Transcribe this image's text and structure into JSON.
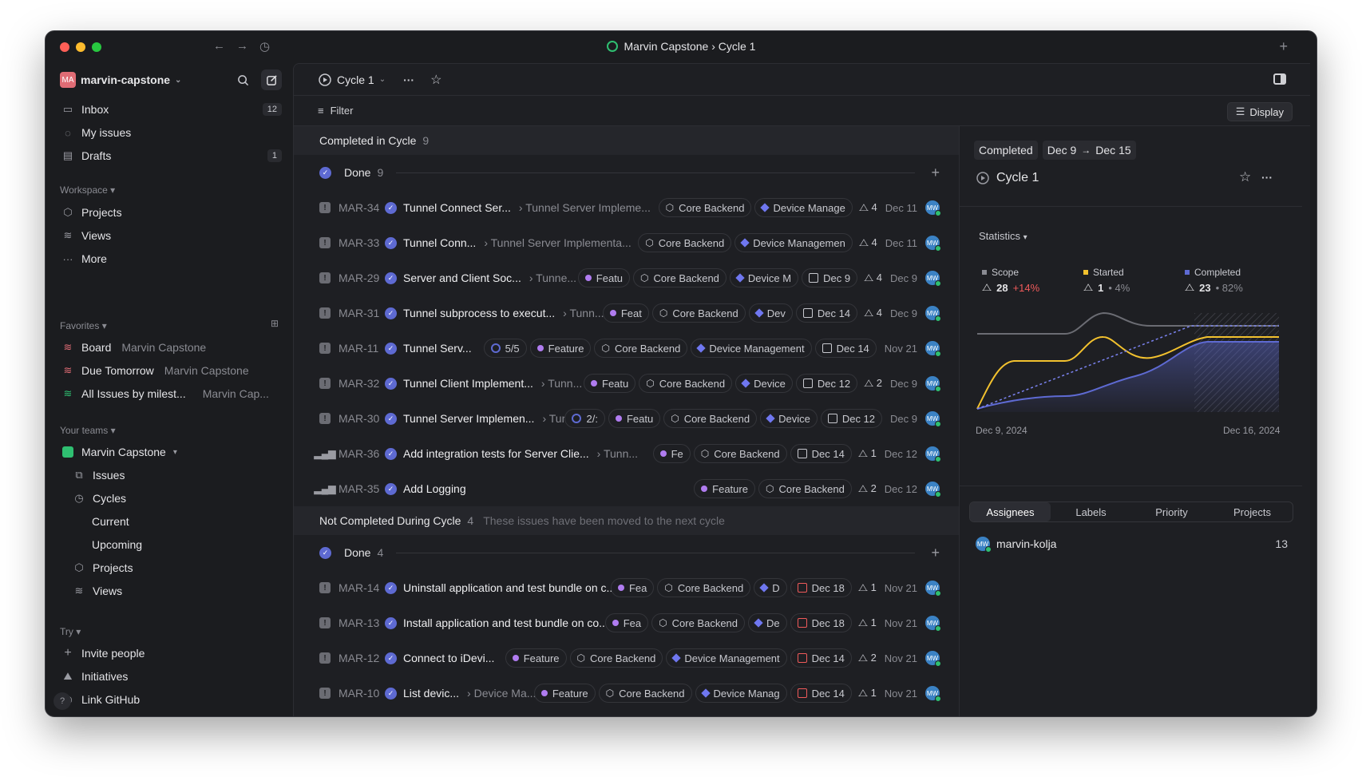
{
  "window": {
    "title": "Marvin Capstone › Cycle 1",
    "traffic_colors": [
      "#ff5f57",
      "#febc2e",
      "#28c840"
    ]
  },
  "sidebar": {
    "workspace_initials": "MA",
    "workspace_name": "marvin-capstone",
    "top_items": [
      {
        "label": "Inbox",
        "badge": "12"
      },
      {
        "label": "My issues",
        "badge": ""
      },
      {
        "label": "Drafts",
        "badge": "1"
      }
    ],
    "workspace_header": "Workspace",
    "workspace_items": [
      {
        "label": "Projects"
      },
      {
        "label": "Views"
      },
      {
        "label": "More"
      }
    ],
    "favorites_header": "Favorites",
    "favorites": [
      {
        "label": "Board",
        "sub": "Marvin Capstone"
      },
      {
        "label": "Due Tomorrow",
        "sub": "Marvin Capstone"
      },
      {
        "label": "All Issues by milest...",
        "sub": "Marvin Cap..."
      }
    ],
    "teams_header": "Your teams",
    "team_name": "Marvin Capstone",
    "team_items": [
      {
        "label": "Issues"
      },
      {
        "label": "Cycles"
      },
      {
        "label": "Current"
      },
      {
        "label": "Upcoming"
      },
      {
        "label": "Projects"
      },
      {
        "label": "Views"
      }
    ],
    "try_header": "Try",
    "try_items": [
      {
        "label": "Invite people"
      },
      {
        "label": "Initiatives"
      },
      {
        "label": "Link GitHub"
      }
    ],
    "help_label": "?"
  },
  "topbar": {
    "cycle_label": "Cycle 1",
    "filter_label": "Filter",
    "display_label": "Display"
  },
  "list": {
    "section1": {
      "label": "Completed in Cycle",
      "count": "9"
    },
    "group1": {
      "label": "Done",
      "count": "9"
    },
    "section2": {
      "label": "Not Completed During Cycle",
      "count": "4",
      "note": "These issues have been moved to the next cycle"
    },
    "group2": {
      "label": "Done",
      "count": "4"
    },
    "issues": [
      {
        "id": "MAR-34",
        "title": "Tunnel Connect Ser...",
        "parent": "Tunnel Server Impleme...",
        "est": "4",
        "date": "Dec 11"
      },
      {
        "id": "MAR-33",
        "title": "Tunnel Conn...",
        "parent": "Tunnel Server Implementa...",
        "est": "4",
        "date": "Dec 11"
      },
      {
        "id": "MAR-29",
        "title": "Server and Client Soc...",
        "parent": "Tunne...",
        "est": "4",
        "date": "Dec 9"
      },
      {
        "id": "MAR-31",
        "title": "Tunnel subprocess to execut...",
        "parent": "Tunn...",
        "est": "4",
        "date": "Dec 9"
      },
      {
        "id": "MAR-11",
        "title": "Tunnel Serv...",
        "parent": "",
        "est": "",
        "date": "Nov 21"
      },
      {
        "id": "MAR-32",
        "title": "Tunnel Client Implement...",
        "parent": "Tunn...",
        "est": "2",
        "date": "Dec 9"
      },
      {
        "id": "MAR-30",
        "title": "Tunnel Server Implemen...",
        "parent": "Tunn...",
        "est": "",
        "date": "Dec 9"
      },
      {
        "id": "MAR-36",
        "title": "Add integration tests for Server Clie...",
        "parent": "Tunn...",
        "est": "1",
        "date": "Dec 12"
      },
      {
        "id": "MAR-35",
        "title": "Add Logging",
        "parent": "",
        "est": "2",
        "date": "Dec 12"
      },
      {
        "id": "MAR-14",
        "title": "Uninstall application and test bundle on c...",
        "parent": "",
        "est": "1",
        "date": "Nov 21"
      },
      {
        "id": "MAR-13",
        "title": "Install application and test bundle on co...",
        "parent": "",
        "est": "1",
        "date": "Nov 21"
      },
      {
        "id": "MAR-12",
        "title": "Connect to iDevi...",
        "parent": "",
        "est": "2",
        "date": "Nov 21"
      },
      {
        "id": "MAR-10",
        "title": "List devic...",
        "parent": "Device Ma...",
        "est": "1",
        "date": "Nov 21"
      }
    ],
    "chips": {
      "feature": "Feature",
      "core": "Core Backend",
      "device": "Device Management",
      "r34_device": "Device Manage",
      "r33_device": "Device Managemen",
      "r29_feat": "Featu",
      "r29_device": "Device M",
      "r29_due": "Dec 9",
      "r31_feat": "Feat",
      "r31_device": "Dev",
      "r31_due": "Dec 14",
      "r11_sub": "5/5",
      "r11_due": "Dec 14",
      "r32_feat": "Featu",
      "r32_device": "Device",
      "r32_due": "Dec 12",
      "r30_sub": "2/:",
      "r30_feat": "Featu",
      "r30_device": "Device",
      "r30_due": "Dec 12",
      "r36_feat": "Fe",
      "r36_due": "Dec 14",
      "r14_feat": "Fea",
      "r14_device": "D",
      "r14_due": "Dec 18",
      "r13_feat": "Fea",
      "r13_device": "De",
      "r13_due": "Dec 18",
      "r12_due": "Dec 14",
      "r10_device": "Device Manag",
      "r10_due": "Dec 14"
    },
    "avatar_initials": "MW"
  },
  "panel": {
    "status": "Completed",
    "start": "Dec 9",
    "end": "Dec 15",
    "cycle_name": "Cycle 1",
    "statistics_label": "Statistics",
    "stats": [
      {
        "label": "Scope",
        "value": "28",
        "delta": "+14%",
        "color": "#8a8b92",
        "delta_color": "#ef5a5a"
      },
      {
        "label": "Started",
        "value": "1",
        "delta": "• 4%",
        "color": "#f2c12e",
        "delta_color": "#8a8b92"
      },
      {
        "label": "Completed",
        "value": "23",
        "delta": "• 82%",
        "color": "#5e6ad2",
        "delta_color": "#8a8b92"
      }
    ],
    "chart_start": "Dec 9, 2024",
    "chart_end": "Dec 16, 2024",
    "tabs": [
      "Assignees",
      "Labels",
      "Priority",
      "Projects"
    ],
    "assignee_name": "marvin-kolja",
    "assignee_count": "13"
  },
  "chart_data": {
    "type": "line",
    "x": [
      "Dec 9, 2024",
      "Dec 16, 2024"
    ],
    "series": [],
    "colors": {
      "scope": "#8a8b92",
      "started": "#f2c12e",
      "completed": "#5e6ad2",
      "target": "#7b83f0"
    }
  }
}
